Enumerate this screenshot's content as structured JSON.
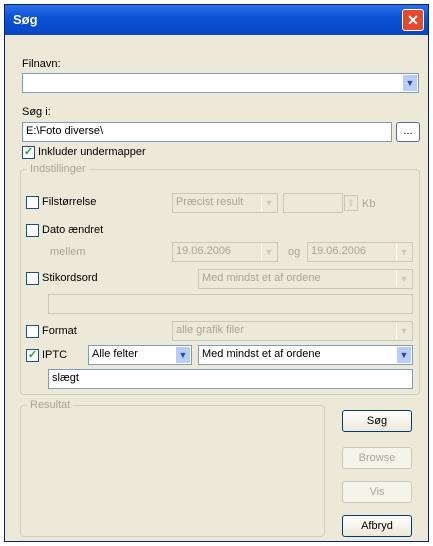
{
  "window": {
    "title": "Søg",
    "close_glyph": "✕"
  },
  "filename": {
    "label": "Filnavn:",
    "value": ""
  },
  "search_in": {
    "label": "Søg i:",
    "value": "E:\\Foto diverse\\",
    "browse_label": "..."
  },
  "include_subfolders": {
    "label": "Inkluder undermapper",
    "checked": true
  },
  "settings": {
    "title": "Indstillinger",
    "filesize": {
      "label": "Filstørrelse",
      "mode": "Præcist result",
      "value": "",
      "unit": "Kb"
    },
    "date_modified": {
      "label": "Dato ændret",
      "between_label": "mellem",
      "from": "19.06.2006",
      "and_label": "og",
      "to": "19.06.2006"
    },
    "keywords": {
      "label": "Stikordsord",
      "mode": "Med mindst et af ordene",
      "value": ""
    },
    "format": {
      "label": "Format",
      "value": "alle grafik filer"
    },
    "iptc": {
      "label": "IPTC",
      "checked": true,
      "field": "Alle felter",
      "mode": "Med mindst et af ordene",
      "value": "slægt"
    }
  },
  "result": {
    "title": "Resultat"
  },
  "buttons": {
    "search": "Søg",
    "browse": "Browse",
    "view": "Vis",
    "cancel": "Afbryd"
  },
  "icons": {
    "dropdown": "▼",
    "spin": "⇕"
  }
}
